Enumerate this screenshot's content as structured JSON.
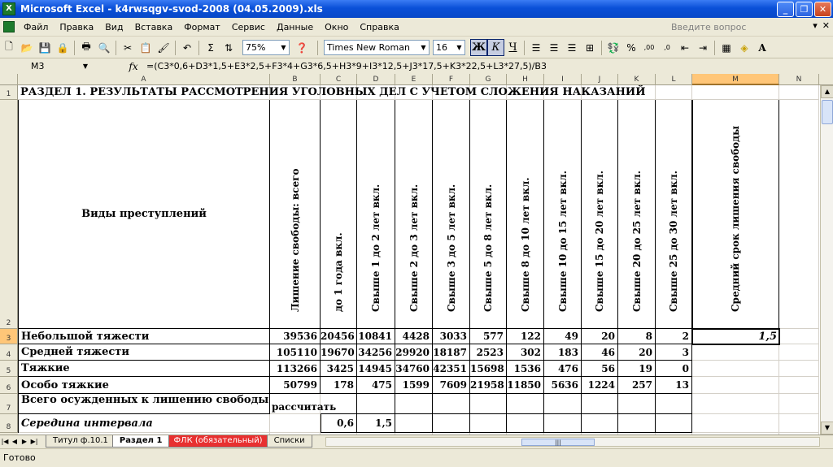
{
  "window": {
    "title": "Microsoft Excel - k4rwsqgv-svod-2008 (04.05.2009).xls",
    "app_icon": "X"
  },
  "menu": {
    "items": [
      "Файл",
      "Правка",
      "Вид",
      "Вставка",
      "Формат",
      "Сервис",
      "Данные",
      "Окно",
      "Справка"
    ],
    "help_placeholder": "Введите вопрос"
  },
  "toolbar": {
    "zoom": "75%",
    "font_name": "Times New Roman",
    "font_size": "16",
    "bold": "Ж",
    "italic": "К",
    "underline": "Ч",
    "autosum": "Σ",
    "percent": "%",
    "font_color": "A"
  },
  "formula_bar": {
    "name_box": "M3",
    "fx": "fx",
    "formula": "=(C3*0,6+D3*1,5+E3*2,5+F3*4+G3*6,5+H3*9+I3*12,5+J3*17,5+K3*22,5+L3*27,5)/B3"
  },
  "columns": [
    "A",
    "B",
    "C",
    "D",
    "E",
    "F",
    "G",
    "H",
    "I",
    "J",
    "K",
    "L",
    "M",
    "N"
  ],
  "selected_column": "M",
  "rows": [
    "1",
    "2",
    "3",
    "4",
    "5",
    "6",
    "7",
    "8"
  ],
  "selected_row": "3",
  "sheet": {
    "title": "РАЗДЕЛ 1. РЕЗУЛЬТАТЫ РАССМОТРЕНИЯ УГОЛОВНЫХ ДЕЛ С УЧЕТОМ СЛОЖЕНИЯ НАКАЗАНИЙ",
    "header_a": "Виды преступлений",
    "vertical_headers": [
      "Лишение свободы: всего",
      "до 1 года вкл.",
      "Свыше 1 до 2 лет вкл.",
      "Свыше 2 до 3 лет вкл.",
      "Свыше 3 до 5 лет вкл.",
      "Свыше 5 до 8 лет вкл.",
      "Свыше 8 до 10 лет вкл.",
      "Свыше 10 до 15 лет вкл.",
      "Свыше 15 до 20 лет вкл.",
      "Свыше 20 до 25 лет вкл.",
      "Свыше 25 до 30 лет вкл.",
      "Средний срок лишения свободы"
    ],
    "data_rows": [
      {
        "label": "Небольшой тяжести",
        "values": [
          "39536",
          "20456",
          "10841",
          "4428",
          "3033",
          "577",
          "122",
          "49",
          "20",
          "8",
          "2"
        ],
        "m": "1,5"
      },
      {
        "label": "Средней тяжести",
        "values": [
          "105110",
          "19670",
          "34256",
          "29920",
          "18187",
          "2523",
          "302",
          "183",
          "46",
          "20",
          "3"
        ],
        "m": ""
      },
      {
        "label": "Тяжкие",
        "values": [
          "113266",
          "3425",
          "14945",
          "34760",
          "42351",
          "15698",
          "1536",
          "476",
          "56",
          "19",
          "0"
        ],
        "m": ""
      },
      {
        "label": "Особо тяжкие",
        "values": [
          "50799",
          "178",
          "475",
          "1599",
          "7609",
          "21958",
          "11850",
          "5636",
          "1224",
          "257",
          "13"
        ],
        "m": ""
      }
    ],
    "row7_label": "Всего осужденных к лишению свободы",
    "row7_b": "рассчитать",
    "row8_label": "Середина интервала",
    "row8_values": [
      "0,6",
      "1,5"
    ]
  },
  "tabs": [
    {
      "label": "Титул ф.10.1",
      "active": false,
      "red": false
    },
    {
      "label": "Раздел 1",
      "active": true,
      "red": false
    },
    {
      "label": "ФЛК (обязательный)",
      "active": false,
      "red": true
    },
    {
      "label": "Списки",
      "active": false,
      "red": false
    }
  ],
  "status": "Готово"
}
